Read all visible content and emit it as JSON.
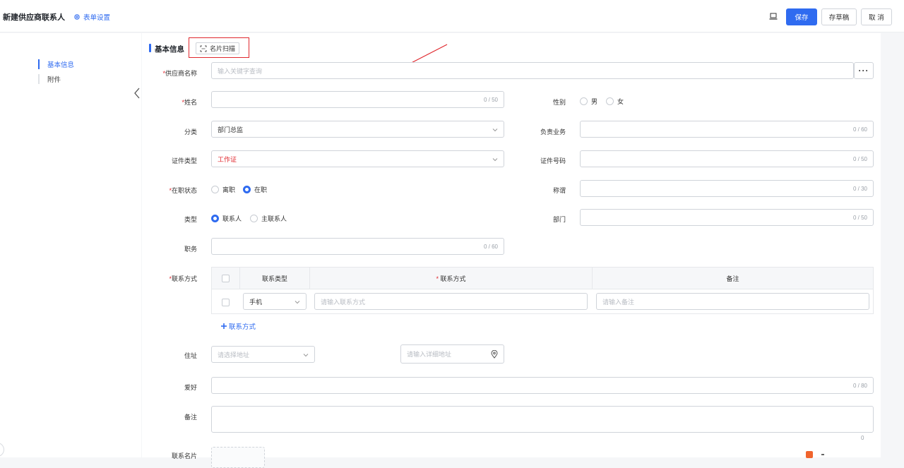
{
  "header": {
    "title": "新建供应商联系人",
    "form_settings": "表单设置",
    "save": "保存",
    "draft": "存草稿",
    "cancel": "取 消"
  },
  "sidenav": {
    "items": [
      {
        "label": "基本信息",
        "active": true
      },
      {
        "label": "附件",
        "active": false
      }
    ]
  },
  "section": {
    "title": "基本信息",
    "scan_button": "名片扫描"
  },
  "fields": {
    "supplier": {
      "label": "供应商名称",
      "placeholder": "输入关键字查询",
      "more": "···"
    },
    "name": {
      "label": "姓名",
      "counter": "0 / 50"
    },
    "gender": {
      "label": "性别",
      "options": [
        "男",
        "女"
      ]
    },
    "category": {
      "label": "分类",
      "value": "部门总监"
    },
    "business": {
      "label": "负责业务",
      "counter": "0 / 60"
    },
    "id_type": {
      "label": "证件类型",
      "value": "工作证"
    },
    "id_number": {
      "label": "证件号码",
      "counter": "0 / 50"
    },
    "status": {
      "label": "在职状态",
      "options": [
        "离职",
        "在职"
      ],
      "selected": "在职"
    },
    "salutation": {
      "label": "称谓",
      "counter": "0 / 30"
    },
    "type": {
      "label": "类型",
      "options": [
        "联系人",
        "主联系人"
      ],
      "selected": "联系人"
    },
    "department": {
      "label": "部门",
      "counter": "0 / 50"
    },
    "position": {
      "label": "职务",
      "counter": "0 / 60"
    },
    "contact": {
      "label": "联系方式",
      "columns": [
        "联系类型",
        "联系方式",
        "备注"
      ],
      "row": {
        "type": "手机",
        "value_placeholder": "请输入联系方式",
        "note_placeholder": "请输入备注"
      },
      "add_label": "联系方式"
    },
    "address": {
      "label": "住址",
      "region_placeholder": "请选择地址",
      "detail_placeholder": "请输入详细地址"
    },
    "hobby": {
      "label": "爱好",
      "counter": "0 / 80"
    },
    "remark": {
      "label": "备注",
      "counter": "0"
    },
    "card": {
      "label": "联系名片"
    }
  },
  "colors": {
    "accent": "#2f6bf0",
    "required": "#e0282e",
    "annotation": "#e0282e"
  }
}
